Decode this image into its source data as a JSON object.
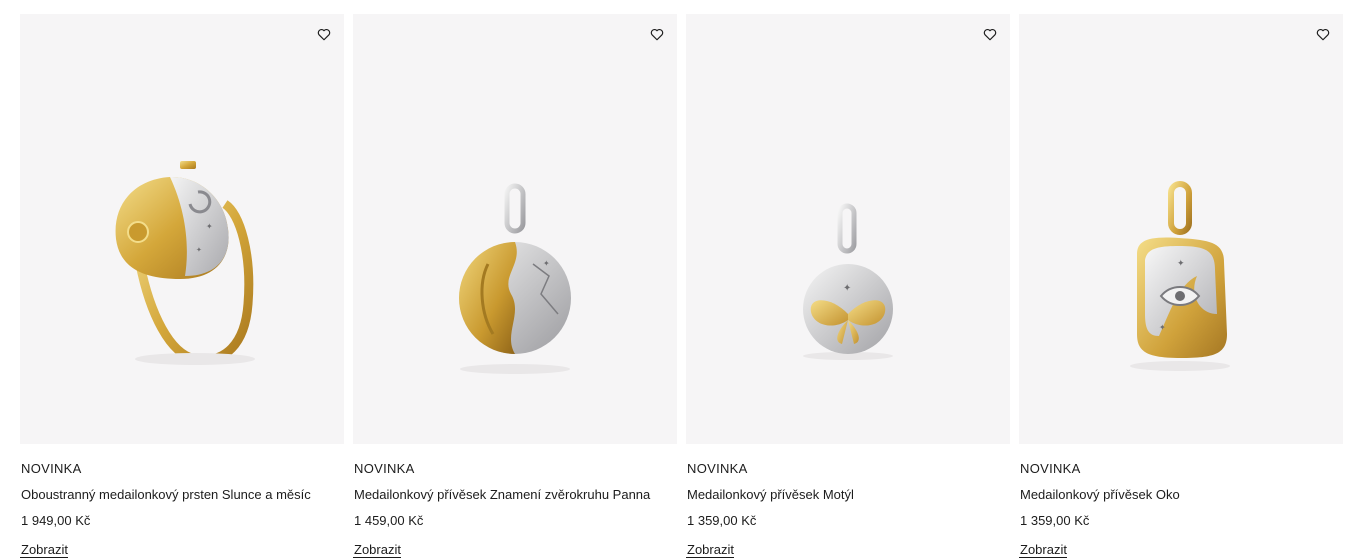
{
  "products": [
    {
      "badge": "NOVINKA",
      "name": "Oboustranný medailonkový prsten Slunce a měsíc",
      "price": "1 949,00 Kč",
      "action": "Zobrazit",
      "image_icon": "ring-sun-moon-image"
    },
    {
      "badge": "NOVINKA",
      "name": "Medailonkový přívěsek Znamení zvěrokruhu Panna",
      "price": "1 459,00 Kč",
      "action": "Zobrazit",
      "image_icon": "virgo-pendant-image"
    },
    {
      "badge": "NOVINKA",
      "name": "Medailonkový přívěsek Motýl",
      "price": "1 359,00 Kč",
      "action": "Zobrazit",
      "image_icon": "butterfly-pendant-image"
    },
    {
      "badge": "NOVINKA",
      "name": "Medailonkový přívěsek Oko",
      "price": "1 359,00 Kč",
      "action": "Zobrazit",
      "image_icon": "eye-pendant-image"
    }
  ],
  "colors": {
    "card_bg": "#f6f5f6",
    "gold": "#d9b44a",
    "silver": "#c9c9cc",
    "text": "#1c1c1c"
  }
}
